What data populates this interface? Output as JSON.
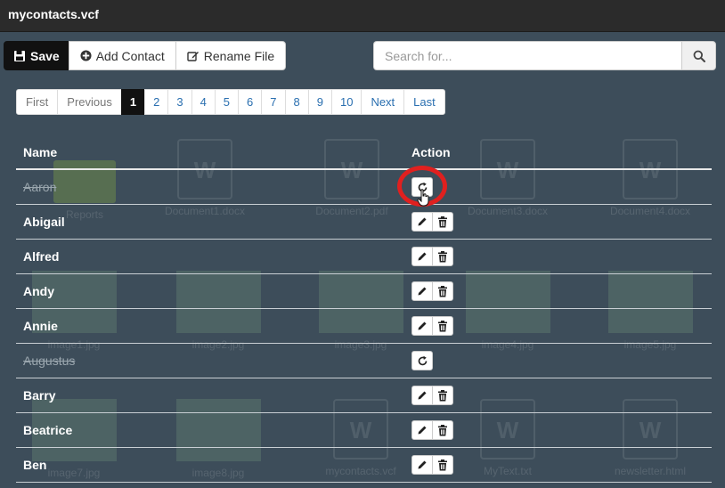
{
  "window": {
    "title": "mycontacts.vcf"
  },
  "toolbar": {
    "save_label": "Save",
    "add_contact_label": "Add Contact",
    "rename_label": "Rename File"
  },
  "search": {
    "placeholder": "Search for..."
  },
  "pagination": {
    "first": "First",
    "previous": "Previous",
    "pages": [
      "1",
      "2",
      "3",
      "4",
      "5",
      "6",
      "7",
      "8",
      "9",
      "10"
    ],
    "active_page": "1",
    "next": "Next",
    "last": "Last"
  },
  "table": {
    "headers": {
      "name": "Name",
      "action": "Action"
    },
    "rows": [
      {
        "name": "Aaron",
        "deleted": true
      },
      {
        "name": "Abigail",
        "deleted": false
      },
      {
        "name": "Alfred",
        "deleted": false
      },
      {
        "name": "Andy",
        "deleted": false
      },
      {
        "name": "Annie",
        "deleted": false
      },
      {
        "name": "Augustus",
        "deleted": true
      },
      {
        "name": "Barry",
        "deleted": false
      },
      {
        "name": "Beatrice",
        "deleted": false
      },
      {
        "name": "Ben",
        "deleted": false
      }
    ]
  },
  "background_files": {
    "labels": [
      "Reports",
      "Document1.docx",
      "Document2.pdf",
      "Document3.docx",
      "Document4.docx",
      "image1.jpg",
      "image2.jpg",
      "image3.jpg",
      "image4.jpg",
      "image5.jpg",
      "image7.jpg",
      "image8.jpg",
      "mycontacts.vcf",
      "MyText.txt",
      "newsletter.html"
    ]
  },
  "colors": {
    "highlight": "#e0201f",
    "overlay": "#3d4d5a",
    "link": "#2a6fb0"
  }
}
